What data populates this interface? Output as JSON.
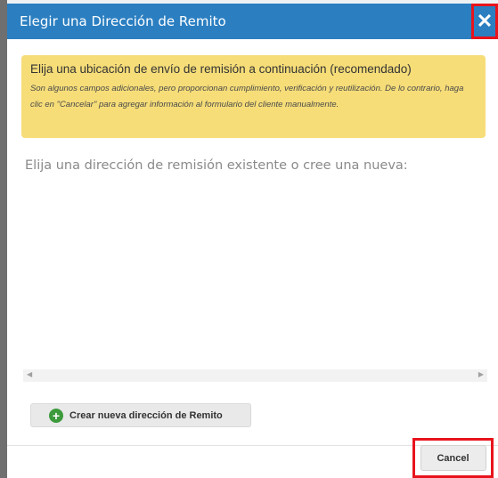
{
  "dialog": {
    "title": "Elegir una Dirección de Remito",
    "close_glyph": "✕"
  },
  "notice": {
    "title": "Elija una ubicación de envío de remisión a continuación (recomendado)",
    "body": "Son algunos campos adicionales, pero proporcionan cumplimiento, verificación y reutilización. De lo contrario, haga clic en \"Cancelar\" para agregar información al formulario del cliente manualmente."
  },
  "prompt": "Elija una dirección de remisión existente o cree una nueva:",
  "scrollbar": {
    "left_arrow": "◀",
    "right_arrow": "▶"
  },
  "create_button": {
    "icon": "plus-circle-icon",
    "label": "Crear nueva dirección de Remito"
  },
  "cancel_button": {
    "label": "Cancel"
  },
  "colors": {
    "titlebar": "#2b7fc1",
    "notice_bg": "#f6dd78",
    "highlight": "#e8131b",
    "plus_icon": "#3c9a3c"
  }
}
